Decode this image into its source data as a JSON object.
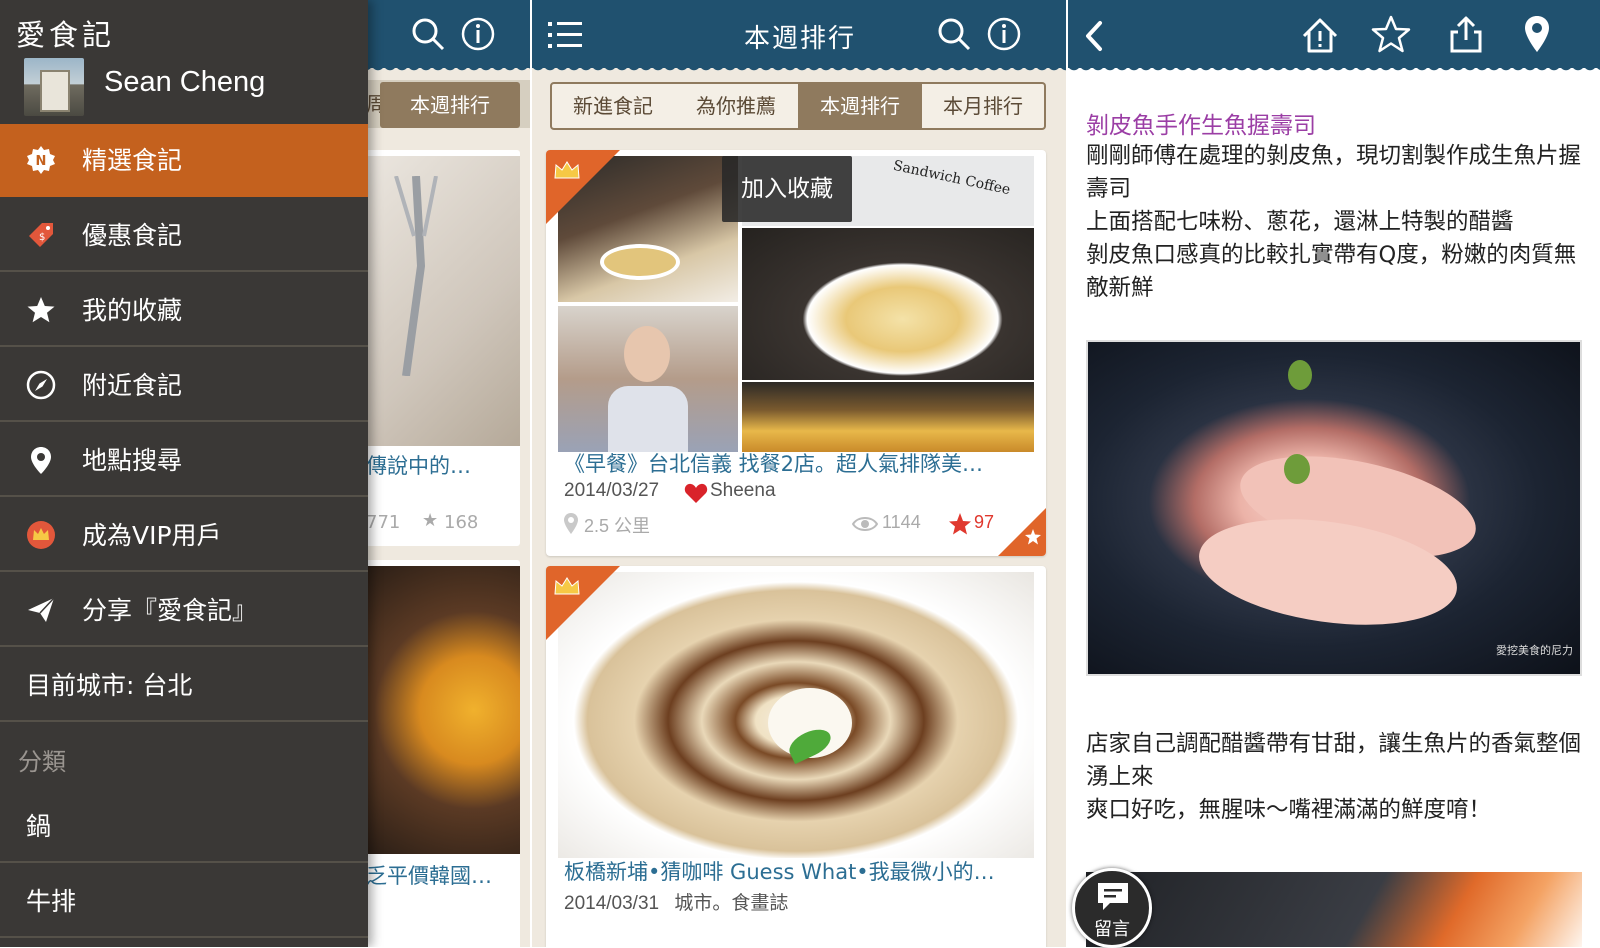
{
  "drawer": {
    "brand": "愛食記",
    "user_name": "Sean Cheng",
    "menu": [
      {
        "label": "精選食記",
        "icon": "new-badge-icon",
        "active": true
      },
      {
        "label": "優惠食記",
        "icon": "coupon-tag-icon"
      },
      {
        "label": "我的收藏",
        "icon": "star-icon"
      },
      {
        "label": "附近食記",
        "icon": "compass-icon"
      },
      {
        "label": "地點搜尋",
        "icon": "location-pin-icon"
      },
      {
        "label": "成為VIP用戶",
        "icon": "crown-icon"
      },
      {
        "label": "分享『愛食記』",
        "icon": "paper-plane-icon"
      }
    ],
    "current_city": "目前城市: 台北",
    "category_header": "分類",
    "categories": [
      "鍋",
      "牛排"
    ]
  },
  "back_panel": {
    "tab_partial": "周",
    "tab_active": "本週排行",
    "card1_title": "傳說中的…",
    "card1_views": "771",
    "card1_likes": "168",
    "card2_title": "乏平價韓國…"
  },
  "list_panel": {
    "title": "本週排行",
    "tabs": [
      "新進食記",
      "為你推薦",
      "本週排行",
      "本月排行"
    ],
    "active_tab": "本週排行",
    "tooltip": "加入收藏",
    "cards": [
      {
        "title": "《早餐》台北信義 找餐2店。超人氣排隊美…",
        "date": "2014/03/27",
        "author": "Sheena",
        "distance": "2.5 公里",
        "views": "1144",
        "likes": "97",
        "photo_text": "Sandwich Coffee"
      },
      {
        "title": "板橋新埔•猜咖啡 Guess What•我最微小的…",
        "date": "2014/03/31",
        "author": "城市。食畫誌"
      }
    ]
  },
  "article": {
    "title": "剝皮魚手作生魚握壽司",
    "paragraph1": "剛剛師傅在處理的剝皮魚，現切割製作成生魚片握壽司\n上面搭配七味粉、蔥花，還淋上特製的醋醬\n剝皮魚口感真的比較扎實帶有Q度，粉嫩的肉質無敵新鮮",
    "paragraph2": "店家自己調配醋醬帶有甘甜，讓生魚片的香氣整個湧上來\n爽口好吃，無腥味～嘴裡滿滿的鮮度唷！",
    "comment_label": "留言",
    "watermark": "愛挖美食的尼力"
  },
  "colors": {
    "header_bg": "#20516f",
    "accent_orange": "#c4611e",
    "drawer_bg": "#3a3836",
    "title_blue": "#2c6e93",
    "article_title_purple": "#9b3ea5"
  }
}
